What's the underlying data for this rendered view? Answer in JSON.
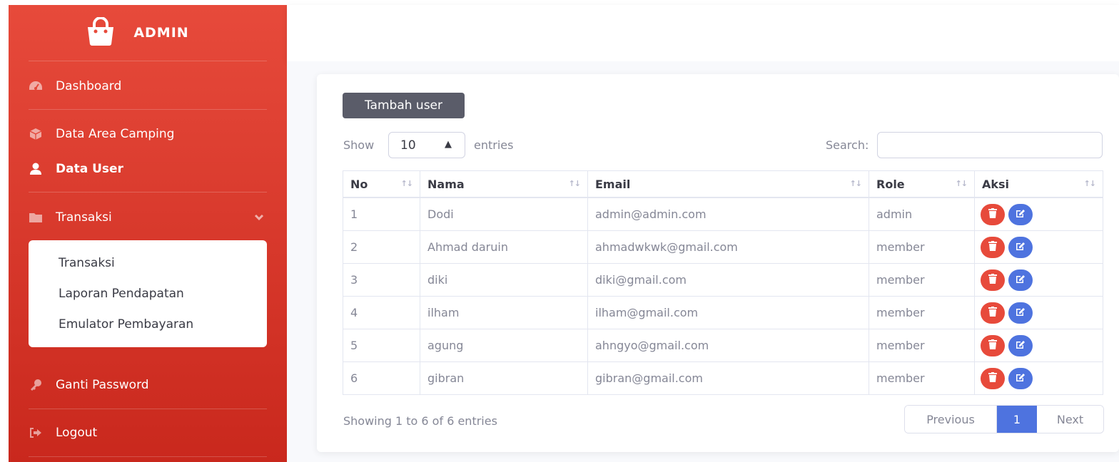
{
  "sidebar": {
    "brand": "ADMIN",
    "items": [
      {
        "label": "Dashboard",
        "icon": "tachometer-icon"
      },
      {
        "label": "Data Area Camping",
        "icon": "cube-icon"
      },
      {
        "label": "Data User",
        "icon": "user-icon",
        "active": true
      },
      {
        "label": "Transaksi",
        "icon": "folder-icon",
        "expanded": true
      },
      {
        "label": "Ganti Password",
        "icon": "key-icon"
      },
      {
        "label": "Logout",
        "icon": "sign-out-icon"
      }
    ],
    "submenu": [
      "Transaksi",
      "Laporan Pendapatan",
      "Emulator Pembayaran"
    ]
  },
  "main": {
    "add_button": "Tambah user",
    "show_label": "Show",
    "entries_value": "10",
    "entries_label": "entries",
    "search_label": "Search:",
    "search_value": "",
    "table": {
      "columns": [
        "No",
        "Nama",
        "Email",
        "Role",
        "Aksi"
      ],
      "rows": [
        {
          "no": "1",
          "nama": "Dodi",
          "email": "admin@admin.com",
          "role": "admin"
        },
        {
          "no": "2",
          "nama": "Ahmad daruin",
          "email": "ahmadwkwk@gmail.com",
          "role": "member"
        },
        {
          "no": "3",
          "nama": "diki",
          "email": "diki@gmail.com",
          "role": "member"
        },
        {
          "no": "4",
          "nama": "ilham",
          "email": "ilham@gmail.com",
          "role": "member"
        },
        {
          "no": "5",
          "nama": "agung",
          "email": "ahngyo@gmail.com",
          "role": "member"
        },
        {
          "no": "6",
          "nama": "gibran",
          "email": "gibran@gmail.com",
          "role": "member"
        }
      ]
    },
    "info": "Showing 1 to 6 of 6 entries",
    "pagination": {
      "previous": "Previous",
      "current": "1",
      "next": "Next"
    }
  },
  "colors": {
    "sidebar_top": "#e74a3b",
    "sidebar_bottom": "#c9281d",
    "delete": "#e74a3b",
    "edit": "#4e73df",
    "primary": "#4e73df",
    "add_button": "#5a5c69"
  }
}
